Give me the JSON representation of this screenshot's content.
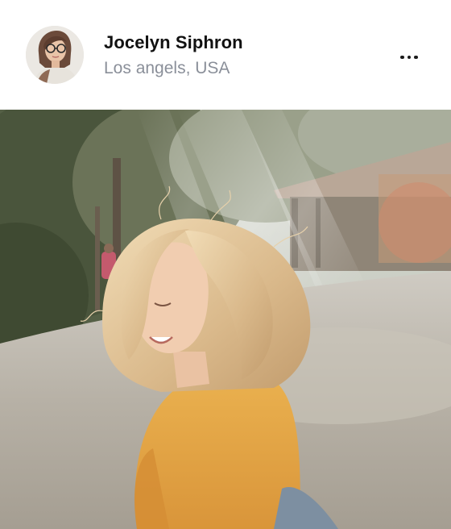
{
  "post": {
    "author": {
      "name": "Jocelyn Siphron",
      "location": "Los angels, USA",
      "avatar_icon": "user-avatar-photo"
    },
    "more_icon": "more-horizontal-icon",
    "photo_icon": "post-photo"
  },
  "colors": {
    "name_text": "#111111",
    "location_text": "#8a8f99",
    "background": "#ffffff",
    "shirt": "#e7a94a",
    "hair": "#e3c59a"
  }
}
